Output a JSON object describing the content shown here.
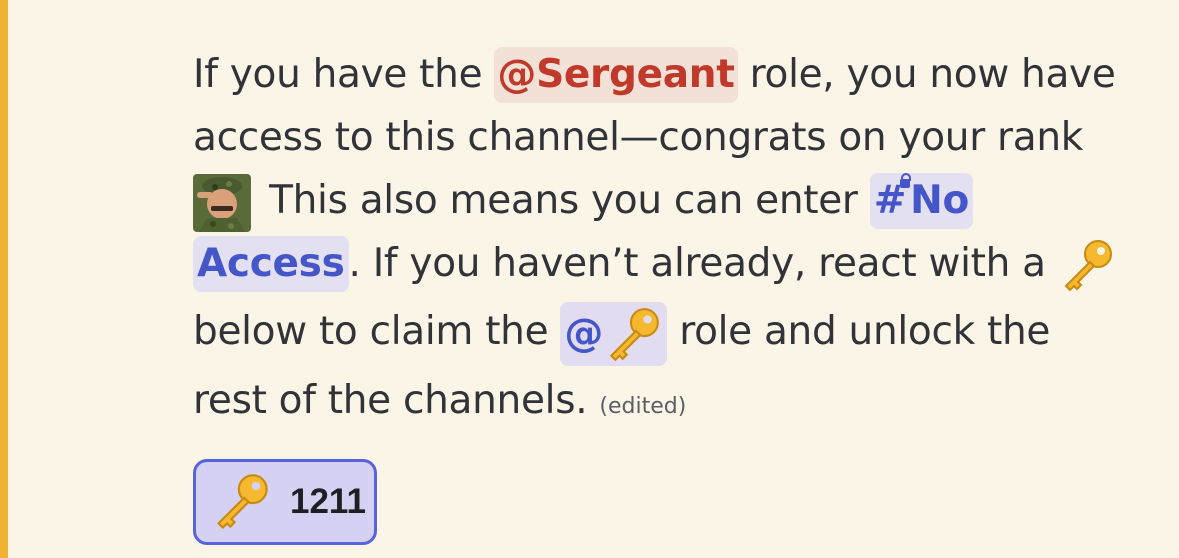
{
  "message": {
    "line1": {
      "before": "If you have the ",
      "role_mention": "@Sergeant",
      "after": " role, you now have"
    },
    "line2": "access to this channel—congrats on your rank",
    "line3": {
      "emoji": "saluting-soldier-icon",
      "text": " This also means you can enter ",
      "channel_mention_part1": "No"
    },
    "line4": {
      "channel_mention_part2": "Access",
      "text": ". If you haven’t already, react with a ",
      "emoji": "key-icon"
    },
    "line5": {
      "before": "below to claim the ",
      "role_mention_prefix": "@",
      "role_mention_emoji": "key-icon",
      "after": " role and unlock the"
    },
    "line6": {
      "text": "rest of the channels. ",
      "edited": "(edited)"
    }
  },
  "reaction": {
    "emoji": "key-icon",
    "count": "1211"
  },
  "colors": {
    "background": "#faf5e6",
    "highlight_bar": "#f0b232",
    "role_sergeant": "#c0392b",
    "mention_blue": "#4556c8",
    "reaction_border": "#5865d8"
  }
}
